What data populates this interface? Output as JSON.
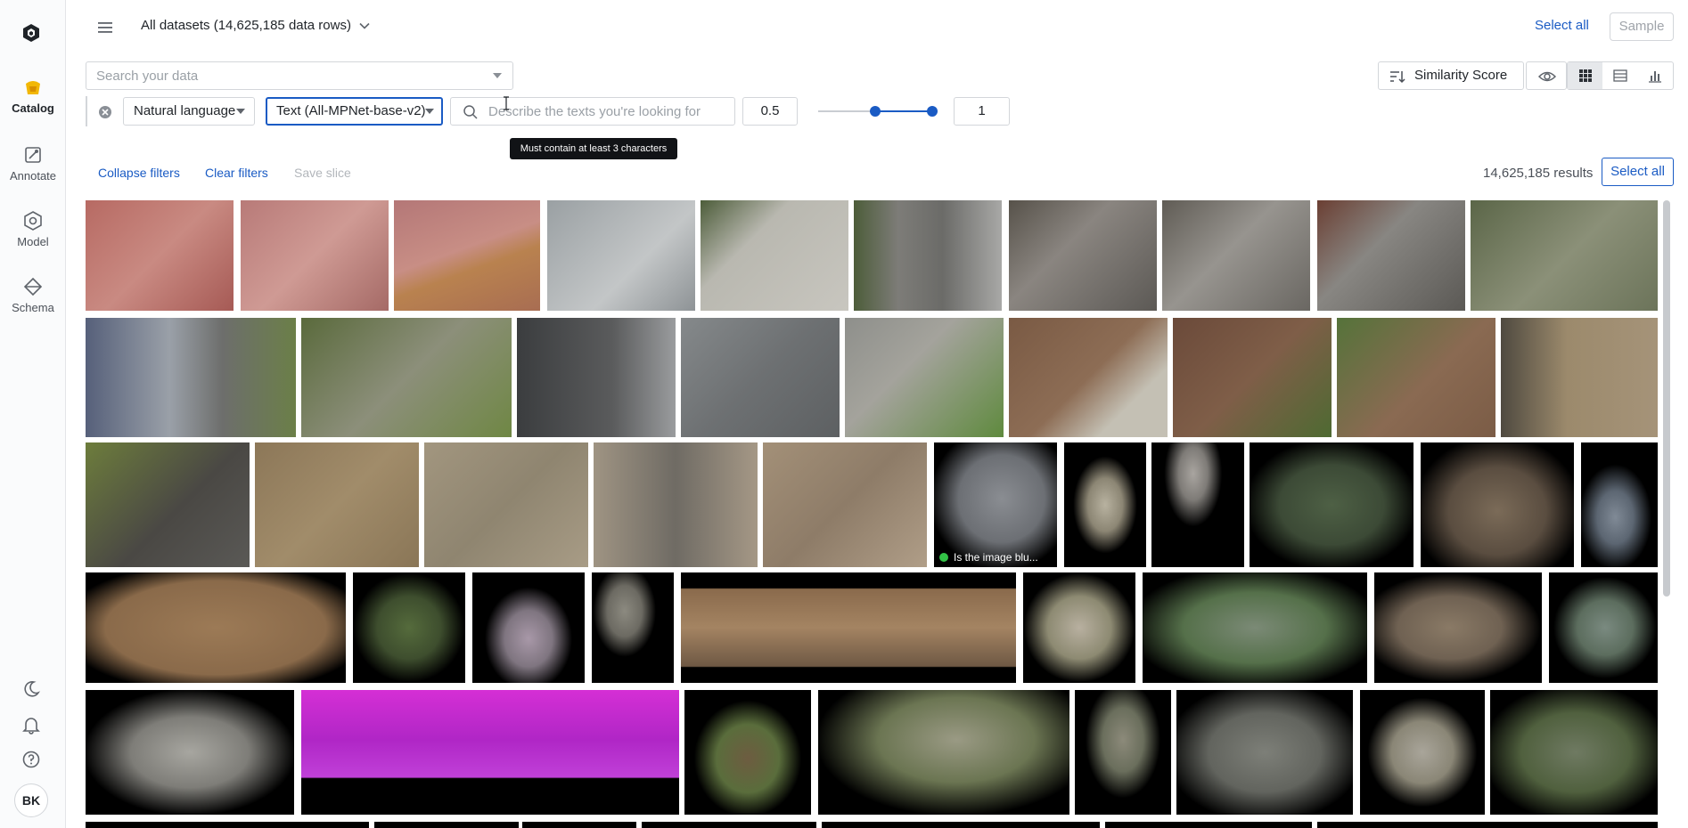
{
  "sidebar": {
    "nav": [
      {
        "key": "catalog",
        "label": "Catalog",
        "icon": "catalog-icon",
        "active": true
      },
      {
        "key": "annotate",
        "label": "Annotate",
        "icon": "annotate-icon",
        "active": false
      },
      {
        "key": "model",
        "label": "Model",
        "icon": "model-icon",
        "active": false
      },
      {
        "key": "schema",
        "label": "Schema",
        "icon": "schema-icon",
        "active": false
      }
    ],
    "utility_icons": [
      "dark-mode-icon",
      "notification-icon",
      "help-icon"
    ],
    "avatar_initials": "BK"
  },
  "header": {
    "dataset_title": "All datasets (14,625,185 data rows)",
    "select_all_label": "Select all",
    "sample_label": "Sample"
  },
  "search": {
    "placeholder": "Search your data",
    "value": ""
  },
  "toolbar": {
    "similarity_label": "Similarity Score",
    "view_modes": [
      "grid",
      "list",
      "chart"
    ],
    "active_view": "grid"
  },
  "filter": {
    "language_value": "Natural language",
    "model_value": "Text (All-MPNet-base-v2)",
    "text_placeholder": "Describe the texts you're looking for",
    "text_value": "",
    "threshold_min": "0.5",
    "threshold_max": "1",
    "slider_min_fraction": 0.5,
    "slider_max_fraction": 1.0,
    "tooltip": "Must contain at least 3 characters"
  },
  "actions": {
    "collapse_filters": "Collapse filters",
    "clear_filters": "Clear filters",
    "save_slice": "Save slice",
    "results_count": "14,625,185 results",
    "select_all": "Select all"
  },
  "gallery": {
    "caption_tile_label": "Is the image blu...",
    "caption_status_color": "#32c146"
  },
  "colors": {
    "accent": "#1a5bc4",
    "catalog_logo": "#f2b705"
  }
}
